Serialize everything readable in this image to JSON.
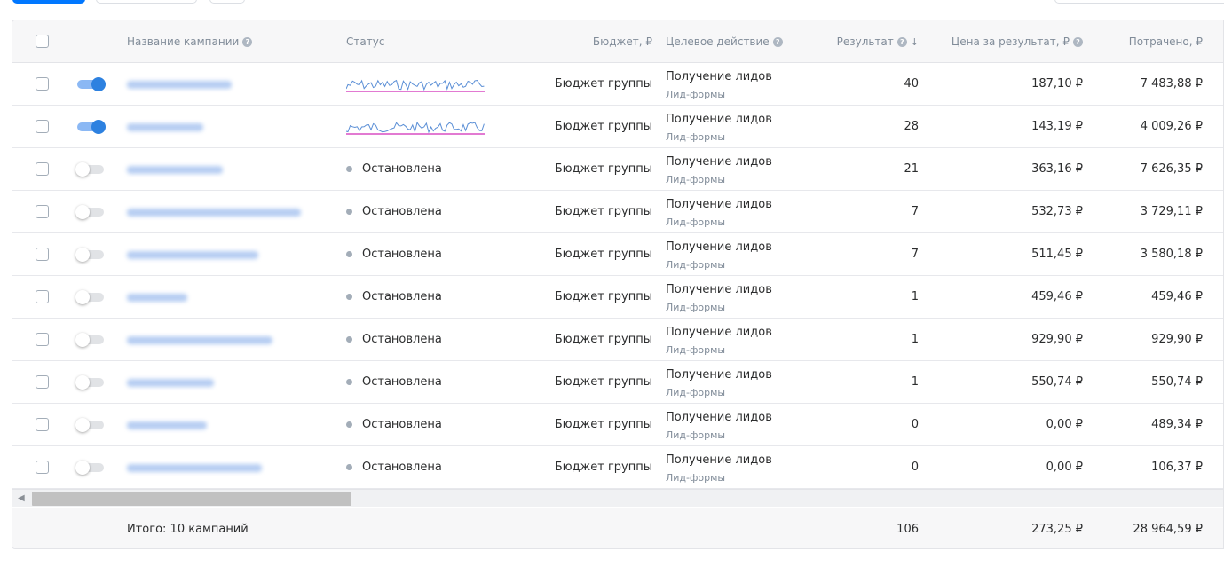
{
  "colors": {
    "accent": "#0077ff",
    "toggle_on": "#2d81e0",
    "status_dot": "#a3adb8",
    "sparkline_blue": "#5b8fd6",
    "sparkline_pink": "#d94fc3"
  },
  "table": {
    "columns": {
      "name": "Название кампании",
      "status": "Статус",
      "budget": "Бюджет, ₽",
      "target": "Целевое действие",
      "result": "Результат",
      "price": "Цена за результат, ₽",
      "spent": "Потрачено, ₽"
    },
    "help_icon": "question-circle-icon",
    "sort_icon": "↓",
    "rows": [
      {
        "active": true,
        "status": "",
        "budget": "Бюджет группы",
        "target": "Получение лидов",
        "target_sub": "Лид-формы",
        "result": "40",
        "price": "187,10 ₽",
        "spent": "7 483,88 ₽"
      },
      {
        "active": true,
        "status": "",
        "budget": "Бюджет группы",
        "target": "Получение лидов",
        "target_sub": "Лид-формы",
        "result": "28",
        "price": "143,19 ₽",
        "spent": "4 009,26 ₽"
      },
      {
        "active": false,
        "status": "Остановлена",
        "budget": "Бюджет группы",
        "target": "Получение лидов",
        "target_sub": "Лид-формы",
        "result": "21",
        "price": "363,16 ₽",
        "spent": "7 626,35 ₽"
      },
      {
        "active": false,
        "status": "Остановлена",
        "budget": "Бюджет группы",
        "target": "Получение лидов",
        "target_sub": "Лид-формы",
        "result": "7",
        "price": "532,73 ₽",
        "spent": "3 729,11 ₽"
      },
      {
        "active": false,
        "status": "Остановлена",
        "budget": "Бюджет группы",
        "target": "Получение лидов",
        "target_sub": "Лид-формы",
        "result": "7",
        "price": "511,45 ₽",
        "spent": "3 580,18 ₽"
      },
      {
        "active": false,
        "status": "Остановлена",
        "budget": "Бюджет группы",
        "target": "Получение лидов",
        "target_sub": "Лид-формы",
        "result": "1",
        "price": "459,46 ₽",
        "spent": "459,46 ₽"
      },
      {
        "active": false,
        "status": "Остановлена",
        "budget": "Бюджет группы",
        "target": "Получение лидов",
        "target_sub": "Лид-формы",
        "result": "1",
        "price": "929,90 ₽",
        "spent": "929,90 ₽"
      },
      {
        "active": false,
        "status": "Остановлена",
        "budget": "Бюджет группы",
        "target": "Получение лидов",
        "target_sub": "Лид-формы",
        "result": "1",
        "price": "550,74 ₽",
        "spent": "550,74 ₽"
      },
      {
        "active": false,
        "status": "Остановлена",
        "budget": "Бюджет группы",
        "target": "Получение лидов",
        "target_sub": "Лид-формы",
        "result": "0",
        "price": "0,00 ₽",
        "spent": "489,34 ₽"
      },
      {
        "active": false,
        "status": "Остановлена",
        "budget": "Бюджет группы",
        "target": "Получение лидов",
        "target_sub": "Лид-формы",
        "result": "0",
        "price": "0,00 ₽",
        "spent": "106,37 ₽"
      }
    ],
    "footer": {
      "total_label": "Итого: 10 кампаний",
      "result": "106",
      "price": "273,25 ₽",
      "spent": "28 964,59 ₽"
    }
  }
}
